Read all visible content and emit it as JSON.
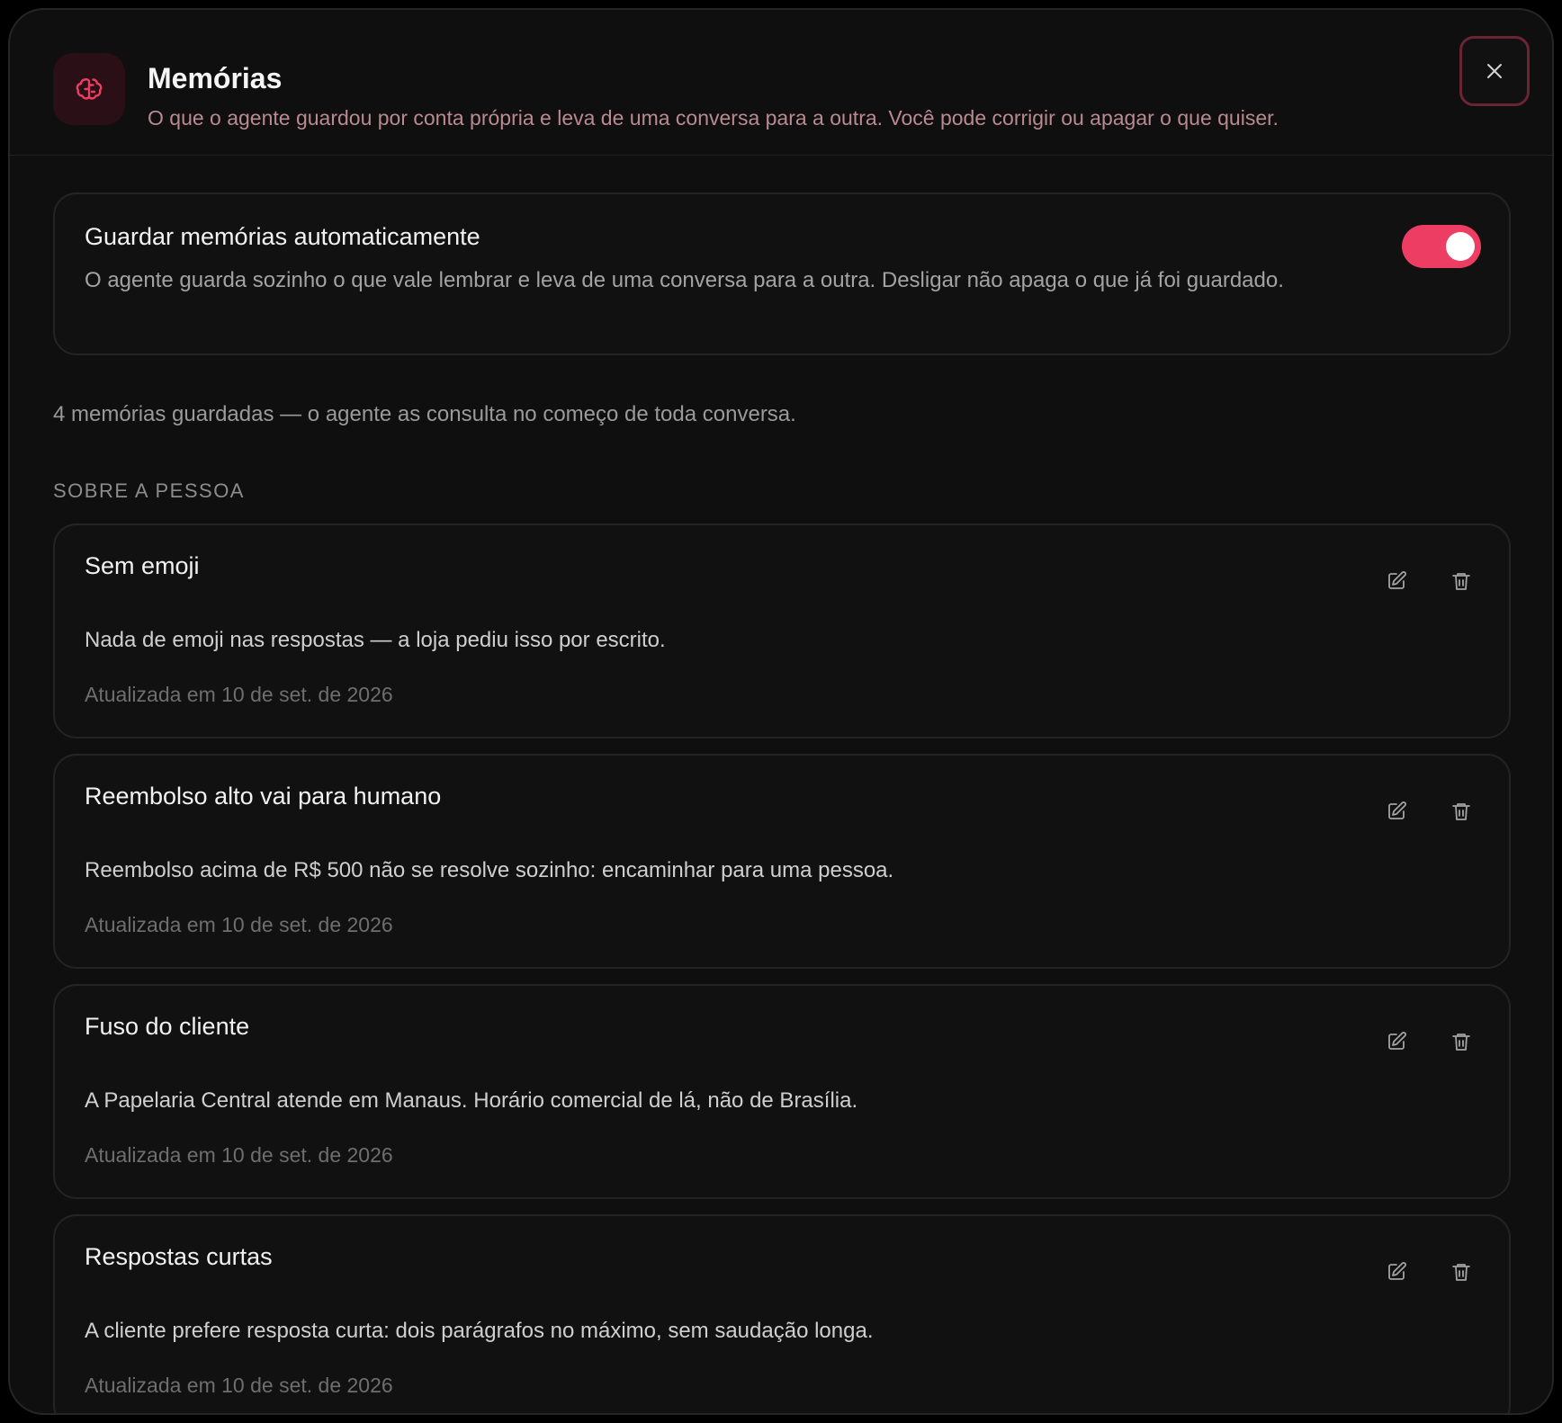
{
  "header": {
    "title": "Memórias",
    "subtitle": "O que o agente guardou por conta própria e leva de uma conversa para a outra. Você pode corrigir ou apagar o que quiser.",
    "icon": "brain-icon",
    "close_icon": "close-icon"
  },
  "auto_save": {
    "title": "Guardar memórias automaticamente",
    "description": "O agente guarda sozinho o que vale lembrar e leva de uma conversa para a outra. Desligar não apaga o que já foi guardado.",
    "enabled": true
  },
  "summary": "4 memórias guardadas — o agente as consulta no começo de toda conversa.",
  "section": {
    "heading": "SOBRE A PESSOA"
  },
  "memories": [
    {
      "title": "Sem emoji",
      "body": "Nada de emoji nas respostas — a loja pediu isso por escrito.",
      "updated": "Atualizada em 10 de set. de 2026"
    },
    {
      "title": "Reembolso alto vai para humano",
      "body": "Reembolso acima de R$ 500 não se resolve sozinho: encaminhar para uma pessoa.",
      "updated": "Atualizada em 10 de set. de 2026"
    },
    {
      "title": "Fuso do cliente",
      "body": "A Papelaria Central atende em Manaus. Horário comercial de lá, não de Brasília.",
      "updated": "Atualizada em 10 de set. de 2026"
    },
    {
      "title": "Respostas curtas",
      "body": "A cliente prefere resposta curta: dois parágrafos no máximo, sem saudação longa.",
      "updated": "Atualizada em 10 de set. de 2026"
    }
  ],
  "colors": {
    "accent": "#ee3d63",
    "background": "#0f0f0f",
    "subtitle": "#b98a90"
  }
}
